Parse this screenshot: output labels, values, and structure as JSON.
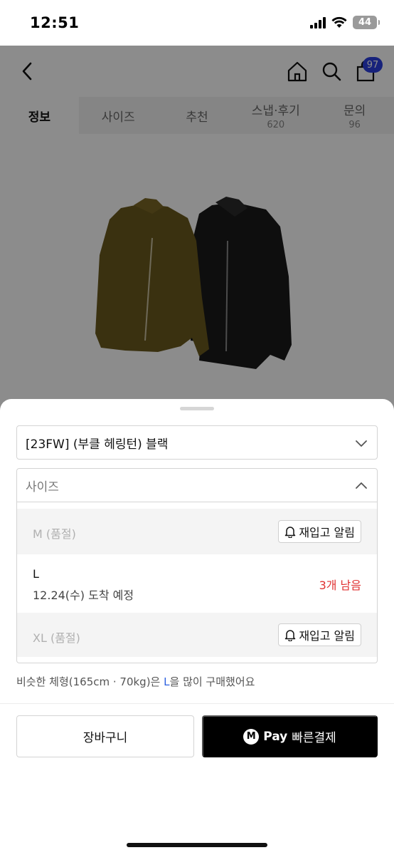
{
  "status_bar": {
    "time": "12:51",
    "battery": "44"
  },
  "header": {
    "cart_count": "97"
  },
  "tabs": [
    {
      "label": "정보",
      "count": ""
    },
    {
      "label": "사이즈",
      "count": ""
    },
    {
      "label": "추천",
      "count": ""
    },
    {
      "label": "스냅·후기",
      "count": "620"
    },
    {
      "label": "문의",
      "count": "96"
    }
  ],
  "sheet": {
    "option_selected": "[23FW] (부클 헤링턴) 블랙",
    "size_placeholder": "사이즈",
    "sizes": [
      {
        "label": "M (품절)",
        "button": "재입고 알림"
      },
      {
        "label": "L",
        "sub": "12.24(수) 도착 예정",
        "stock": "3개 남음"
      },
      {
        "label": "XL (품절)",
        "button": "재입고 알림"
      }
    ],
    "recommend": {
      "prefix": "비슷한 체형(165cm · 70kg)은 ",
      "size": "L",
      "suffix": "을 많이 구매했어요"
    },
    "cart_button": "장바구니",
    "pay_logo": "M",
    "pay_word": "Pay",
    "pay_label": "빠른결제"
  },
  "colors": {
    "accent": "#2b3fe0",
    "stock_red": "#e03131",
    "olive_jacket": "#6b5a1e",
    "black_jacket": "#1a1a1a"
  }
}
